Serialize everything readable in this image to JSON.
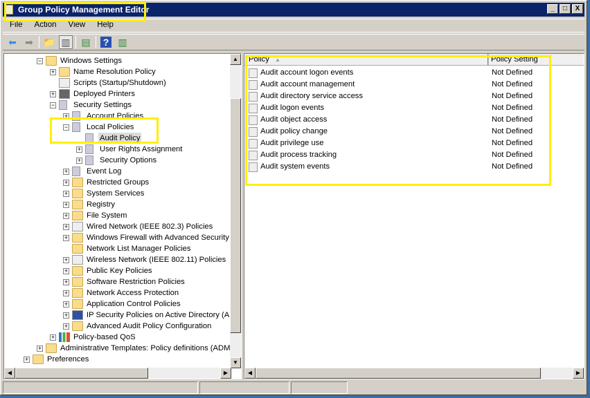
{
  "window": {
    "title": "Group Policy Management Editor",
    "minimize": "_",
    "maximize": "□",
    "close": "X"
  },
  "menu": [
    "File",
    "Action",
    "View",
    "Help"
  ],
  "toolbar": [
    {
      "name": "back-icon",
      "glyph": "⬅",
      "color": "#3a8ee0"
    },
    {
      "name": "forward-icon",
      "glyph": "➡",
      "color": "#888"
    },
    {
      "name": "up-folder-icon",
      "glyph": "📁",
      "color": "#c9a74e"
    },
    {
      "name": "show-hide-tree-icon",
      "glyph": "▥",
      "color": "#555"
    },
    {
      "name": "export-list-icon",
      "glyph": "▤",
      "color": "#3a8a3a"
    },
    {
      "name": "help-icon",
      "glyph": "?",
      "color": "#fff"
    },
    {
      "name": "action-pane-icon",
      "glyph": "▥",
      "color": "#3a8a3a"
    }
  ],
  "tree": [
    {
      "label": "Windows Settings",
      "level": 2,
      "exp": "-",
      "icon": "folder"
    },
    {
      "label": "Name Resolution Policy",
      "level": 3,
      "exp": "+",
      "icon": "folder"
    },
    {
      "label": "Scripts (Startup/Shutdown)",
      "level": 3,
      "exp": "",
      "icon": "doc"
    },
    {
      "label": "Deployed Printers",
      "level": 3,
      "exp": "+",
      "icon": "printer"
    },
    {
      "label": "Security Settings",
      "level": 3,
      "exp": "-",
      "icon": "secure"
    },
    {
      "label": "Account Policies",
      "level": 4,
      "exp": "+",
      "icon": "server"
    },
    {
      "label": "Local Policies",
      "level": 4,
      "exp": "-",
      "icon": "server"
    },
    {
      "label": "Audit Policy",
      "level": 5,
      "exp": "",
      "icon": "server",
      "selected": true
    },
    {
      "label": "User Rights Assignment",
      "level": 5,
      "exp": "+",
      "icon": "server"
    },
    {
      "label": "Security Options",
      "level": 5,
      "exp": "+",
      "icon": "server"
    },
    {
      "label": "Event Log",
      "level": 4,
      "exp": "+",
      "icon": "server"
    },
    {
      "label": "Restricted Groups",
      "level": 4,
      "exp": "+",
      "icon": "secure-folder"
    },
    {
      "label": "System Services",
      "level": 4,
      "exp": "+",
      "icon": "secure-folder"
    },
    {
      "label": "Registry",
      "level": 4,
      "exp": "+",
      "icon": "secure-folder"
    },
    {
      "label": "File System",
      "level": 4,
      "exp": "+",
      "icon": "secure-folder"
    },
    {
      "label": "Wired Network (IEEE 802.3) Policies",
      "level": 4,
      "exp": "+",
      "icon": "network"
    },
    {
      "label": "Windows Firewall with Advanced Security",
      "level": 4,
      "exp": "+",
      "icon": "folder"
    },
    {
      "label": "Network List Manager Policies",
      "level": 4,
      "exp": "",
      "icon": "folder"
    },
    {
      "label": "Wireless Network (IEEE 802.11) Policies",
      "level": 4,
      "exp": "+",
      "icon": "network"
    },
    {
      "label": "Public Key Policies",
      "level": 4,
      "exp": "+",
      "icon": "folder"
    },
    {
      "label": "Software Restriction Policies",
      "level": 4,
      "exp": "+",
      "icon": "folder"
    },
    {
      "label": "Network Access Protection",
      "level": 4,
      "exp": "+",
      "icon": "folder"
    },
    {
      "label": "Application Control Policies",
      "level": 4,
      "exp": "+",
      "icon": "folder"
    },
    {
      "label": "IP Security Policies on Active Directory (AD",
      "level": 4,
      "exp": "+",
      "icon": "ipsec"
    },
    {
      "label": "Advanced Audit Policy Configuration",
      "level": 4,
      "exp": "+",
      "icon": "folder"
    },
    {
      "label": "Policy-based QoS",
      "level": 3,
      "exp": "+",
      "icon": "chart"
    },
    {
      "label": "Administrative Templates: Policy definitions (ADMX",
      "level": 2,
      "exp": "+",
      "icon": "folder"
    },
    {
      "label": "Preferences",
      "level": 1,
      "exp": "+",
      "icon": "folder"
    }
  ],
  "list": {
    "columns": [
      "Policy",
      "Policy Setting"
    ],
    "rows": [
      [
        "Audit account logon events",
        "Not Defined"
      ],
      [
        "Audit account management",
        "Not Defined"
      ],
      [
        "Audit directory service access",
        "Not Defined"
      ],
      [
        "Audit logon events",
        "Not Defined"
      ],
      [
        "Audit object access",
        "Not Defined"
      ],
      [
        "Audit policy change",
        "Not Defined"
      ],
      [
        "Audit privilege use",
        "Not Defined"
      ],
      [
        "Audit process tracking",
        "Not Defined"
      ],
      [
        "Audit system events",
        "Not Defined"
      ]
    ]
  },
  "colors": {
    "titlebar": "#0a246a",
    "highlight": "#ffef00"
  }
}
